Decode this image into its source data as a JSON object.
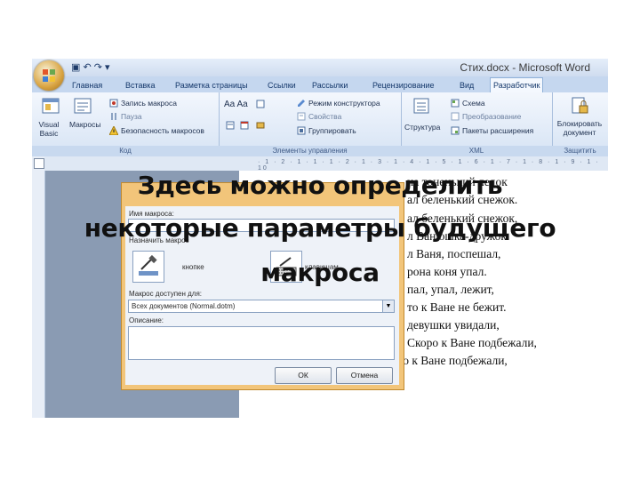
{
  "window": {
    "title": "Стих.docx - Microsoft Word",
    "quick_access": "▣ ↶ ↷ ▾"
  },
  "tabs": [
    "Главная",
    "Вставка",
    "Разметка страницы",
    "Ссылки",
    "Рассылки",
    "Рецензирование",
    "Вид",
    "Разработчик"
  ],
  "ribbon": {
    "code": {
      "visual_basic": "Visual Basic",
      "macros": "Макросы",
      "record": "Запись макроса",
      "pause": "Пауза",
      "security": "Безопасность макросов",
      "group": "Код"
    },
    "controls": {
      "design_mode": "Режим конструктора",
      "properties": "Свойства",
      "group_btn": "Группировать",
      "group": "Элементы управления"
    },
    "xml": {
      "structure": "Структура",
      "schema": "Схема",
      "transform": "Преобразование",
      "packs": "Пакеты расширения",
      "group": "XML"
    },
    "protect": {
      "block": "Блокировать документ",
      "group": "Защитить"
    }
  },
  "document": {
    "lines": [
      "на тоненький ледок",
      "ал беленький снежок.",
      "ал беленький снежок,",
      "л  Ванюшка-дружок.",
      "л Ваня, поспешал,",
      "рона коня упал.",
      "пал, упал, лежит,",
      "то к Ване не бежит.",
      "девушки увидали,",
      "Скоро к Ване подбежали,",
      "Строка 11. Скоро к Ване подбежали,"
    ]
  },
  "dialog": {
    "name_label": "Имя макроса:",
    "assign_label": "Назначить макрос",
    "button_label": "кнопке",
    "keyboard_label": "клавишам",
    "store_label": "Макрос доступен для:",
    "store_value": "Всех документов (Normal.dotm)",
    "desc_label": "Описание:",
    "ok": "ОК",
    "cancel": "Отмена"
  },
  "caption": {
    "line1": "Здесь можно определить",
    "line2": "некоторые параметры будущего",
    "line3": "макроса"
  },
  "colors": {
    "ribbon": "#dce7f5",
    "dialog_border": "#f2c57a"
  }
}
